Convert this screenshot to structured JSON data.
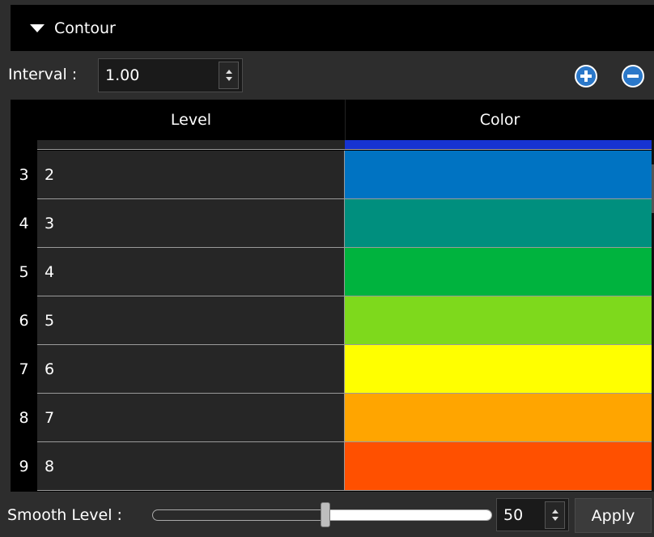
{
  "panel": {
    "title": "Contour"
  },
  "interval": {
    "label": "Interval :",
    "value": "1.00"
  },
  "table": {
    "headers": {
      "level": "Level",
      "color": "Color"
    },
    "partial_row_color": "#1633d2",
    "rows": [
      {
        "row_num": "3",
        "level": "2",
        "color": "#0073c2"
      },
      {
        "row_num": "4",
        "level": "3",
        "color": "#008f7e"
      },
      {
        "row_num": "5",
        "level": "4",
        "color": "#00b33e"
      },
      {
        "row_num": "6",
        "level": "5",
        "color": "#7ed91c"
      },
      {
        "row_num": "7",
        "level": "6",
        "color": "#ffff00"
      },
      {
        "row_num": "8",
        "level": "7",
        "color": "#ffa500"
      },
      {
        "row_num": "9",
        "level": "8",
        "color": "#ff5000"
      }
    ]
  },
  "smooth": {
    "label": "Smooth Level :",
    "value": "50",
    "slider_fraction": 0.5
  },
  "buttons": {
    "apply": "Apply"
  },
  "icons": {
    "expand": "triangle-down-icon",
    "add": "plus-circle-icon",
    "remove": "minus-circle-icon"
  },
  "colors": {
    "accent": "#2b78c9"
  }
}
